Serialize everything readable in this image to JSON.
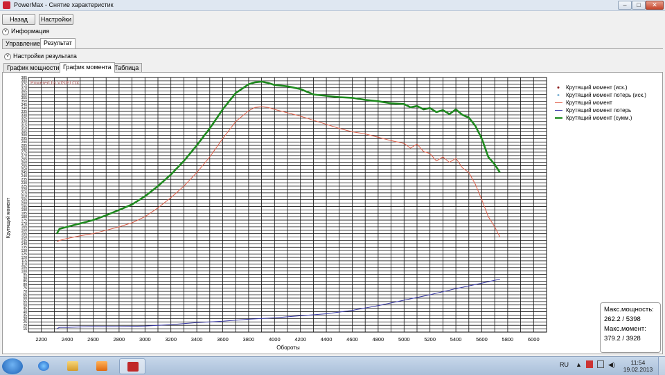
{
  "window": {
    "title": "PowerMax - Снятие характеристик",
    "min": "–",
    "max": "□",
    "close": "✕"
  },
  "toolbar": {
    "back_label": "Назад",
    "settings_label": "Настройки"
  },
  "info_section": {
    "label": "Информация",
    "icon": "chevron-down-icon"
  },
  "main_tabs": [
    {
      "label": "Управление"
    },
    {
      "label": "Результат"
    }
  ],
  "result_settings": {
    "label": "Настройки результата"
  },
  "chart_tabs": [
    {
      "label": "График мощности"
    },
    {
      "label": "График момента"
    },
    {
      "label": "Таблица"
    }
  ],
  "watermark": "Powered by VISIFLOX",
  "chart_data": {
    "type": "line",
    "xlabel": "Обороты",
    "ylabel": "Крутящий момент",
    "xlim": [
      2100,
      6100
    ],
    "ylim": [
      10,
      385
    ],
    "x_ticks": [
      2200,
      2400,
      2600,
      2800,
      3000,
      3200,
      3400,
      3600,
      3800,
      4000,
      4200,
      4400,
      4600,
      4800,
      5000,
      5200,
      5400,
      5600,
      5800,
      6000
    ],
    "y_ticks": [
      15,
      20,
      25,
      30,
      35,
      40,
      45,
      50,
      55,
      60,
      65,
      70,
      75,
      80,
      85,
      90,
      95,
      100,
      105,
      110,
      115,
      120,
      125,
      130,
      135,
      140,
      145,
      150,
      155,
      160,
      165,
      170,
      175,
      180,
      185,
      190,
      195,
      200,
      205,
      210,
      215,
      220,
      225,
      230,
      235,
      240,
      245,
      250,
      255,
      260,
      265,
      270,
      275,
      280,
      285,
      290,
      295,
      300,
      305,
      310,
      315,
      320,
      325,
      330,
      335,
      340,
      345,
      350,
      355,
      360,
      365,
      370,
      375,
      380,
      385
    ],
    "grid": true,
    "legend_position": "right",
    "legend": [
      {
        "name": "Крутящий момент (иск.)",
        "color": "#8b1a1a",
        "marker": "dot"
      },
      {
        "name": "Крутящий момент потерь (иск.)",
        "color": "#7fb3d5",
        "marker": "dot"
      },
      {
        "name": "Крутящий момент",
        "color": "#e0604a",
        "marker": "line"
      },
      {
        "name": "Крутящий момент потерь",
        "color": "#3a3aa8",
        "marker": "line"
      },
      {
        "name": "Крутящий момент (сумм.)",
        "color": "#1f8a1f",
        "marker": "thickline"
      }
    ],
    "series": [
      {
        "name": "Крутящий момент (сумм.)",
        "color": "#1f8a1f",
        "x": [
          2320,
          2340,
          2400,
          2500,
          2600,
          2700,
          2800,
          2900,
          3000,
          3100,
          3200,
          3300,
          3400,
          3500,
          3600,
          3700,
          3800,
          3850,
          3900,
          3950,
          4000,
          4100,
          4200,
          4300,
          4400,
          4500,
          4600,
          4700,
          4800,
          4900,
          5000,
          5050,
          5100,
          5150,
          5200,
          5250,
          5300,
          5350,
          5400,
          5450,
          5500,
          5550,
          5600,
          5650,
          5700,
          5740
        ],
        "y": [
          155,
          162,
          165,
          170,
          175,
          182,
          190,
          198,
          210,
          225,
          242,
          262,
          285,
          310,
          338,
          362,
          375,
          378,
          379,
          377,
          374,
          372,
          368,
          360,
          358,
          356,
          355,
          352,
          350,
          347,
          346,
          341,
          343,
          338,
          340,
          334,
          337,
          331,
          338,
          330,
          326,
          314,
          295,
          268,
          257,
          245
        ]
      },
      {
        "name": "Крутящий момент",
        "color": "#e0604a",
        "x": [
          2320,
          2340,
          2400,
          2500,
          2600,
          2700,
          2800,
          2900,
          3000,
          3100,
          3200,
          3300,
          3400,
          3500,
          3600,
          3700,
          3800,
          3850,
          3900,
          3950,
          4000,
          4100,
          4200,
          4300,
          4400,
          4500,
          4600,
          4700,
          4800,
          4900,
          5000,
          5050,
          5100,
          5150,
          5200,
          5250,
          5300,
          5350,
          5400,
          5450,
          5500,
          5550,
          5600,
          5650,
          5700,
          5740
        ],
        "y": [
          143,
          145,
          148,
          152,
          155,
          160,
          165,
          171,
          180,
          193,
          208,
          225,
          245,
          268,
          295,
          320,
          336,
          341,
          342,
          341,
          338,
          333,
          328,
          322,
          316,
          310,
          305,
          302,
          297,
          292,
          288,
          281,
          287,
          276,
          273,
          262,
          268,
          260,
          266,
          252,
          245,
          228,
          205,
          180,
          165,
          150
        ]
      },
      {
        "name": "Крутящий момент потерь",
        "color": "#3a3aa8",
        "x": [
          2320,
          2340,
          2400,
          2600,
          2800,
          3000,
          3200,
          3400,
          3600,
          3800,
          4000,
          4200,
          4400,
          4600,
          4800,
          5000,
          5200,
          5400,
          5600,
          5740
        ],
        "y": [
          15,
          17,
          17,
          18,
          18,
          19,
          21,
          24,
          26,
          29,
          31,
          34,
          37,
          42,
          49,
          57,
          65,
          74,
          82,
          88
        ]
      }
    ]
  },
  "max_info": {
    "power_label": "Макс.мощность:",
    "power_value": "262.2 / 5398",
    "torque_label": "Макс.момент:",
    "torque_value": "379.2 / 3928"
  },
  "taskbar": {
    "lang": "RU",
    "time": "11:54",
    "date": "19.02.2013"
  }
}
